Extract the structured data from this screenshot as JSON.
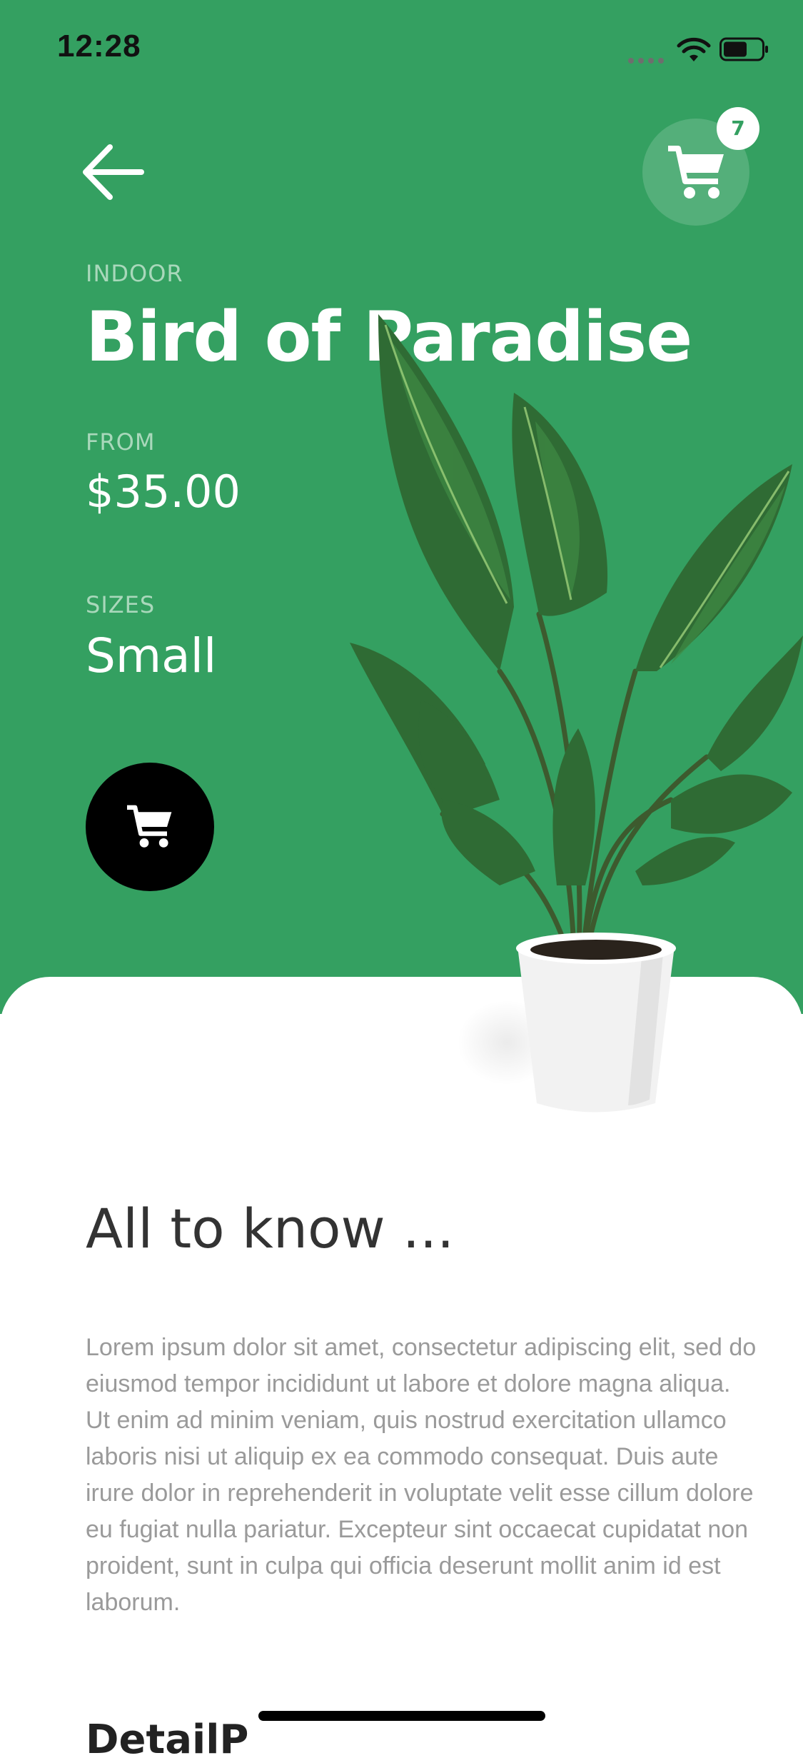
{
  "status_bar": {
    "time": "12:28"
  },
  "header": {
    "cart_count": "7"
  },
  "product": {
    "category": "INDOOR",
    "name": "Bird of Paradise",
    "price_label": "FROM",
    "price": "$35.00",
    "sizes_label": "SIZES",
    "size": "Small"
  },
  "details": {
    "heading": "All to know ...",
    "body": "Lorem ipsum dolor sit amet, consectetur adipiscing elit, sed do eiusmod tempor incididunt ut labore et dolore magna aliqua. Ut enim ad minim veniam, quis nostrud exercitation ullamco laboris nisi ut aliquip ex ea commodo consequat. Duis aute irure dolor in reprehenderit in voluptate velit esse cillum dolore eu fugiat nulla pariatur. Excepteur sint occaecat cupidatat non proident, sunt in culpa qui officia deserunt mollit anim id est laborum.",
    "next_heading": "DetailP"
  },
  "colors": {
    "brand_green": "#34a061",
    "accent_dark": "#000000"
  },
  "icons": [
    "back-arrow-icon",
    "cart-icon",
    "wifi-icon",
    "battery-icon"
  ]
}
